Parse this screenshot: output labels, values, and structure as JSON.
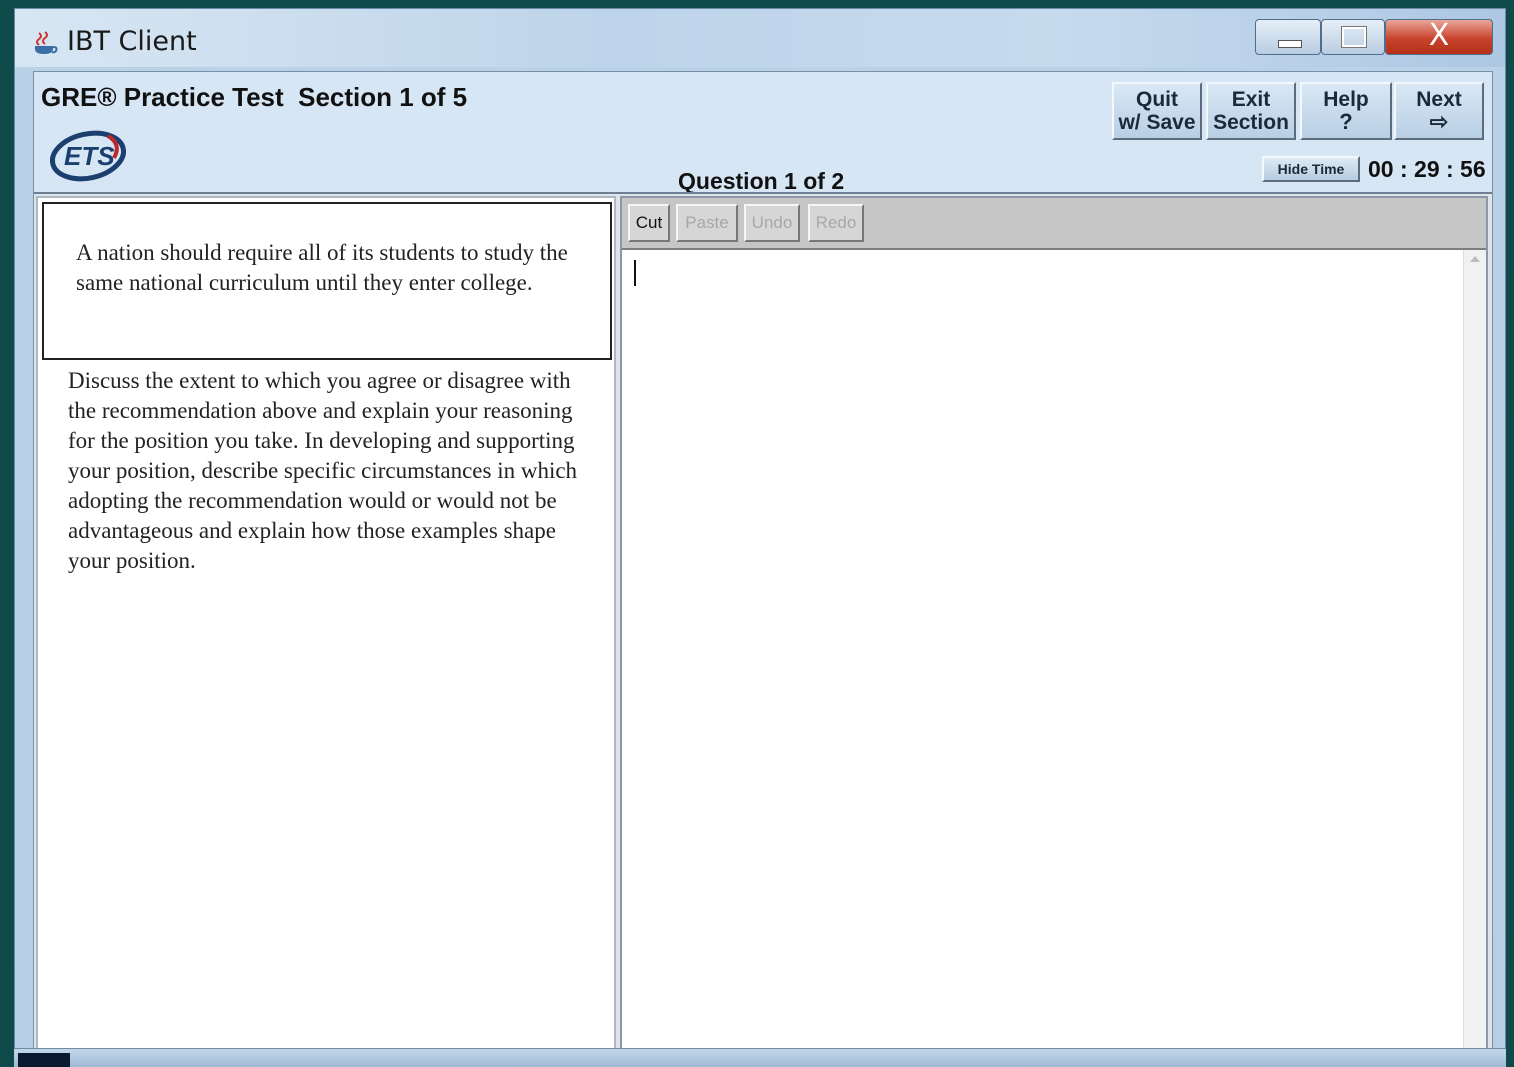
{
  "window": {
    "title": "IBT Client",
    "close_label": "X"
  },
  "header": {
    "test_title": "GRE® Practice Test  Section 1 of 5",
    "logo_text": "ETS",
    "question_counter": "Question 1 of 2",
    "buttons": {
      "quit_line1": "Quit",
      "quit_line2": "w/ Save",
      "exit_line1": "Exit",
      "exit_line2": "Section",
      "help_label": "Help",
      "help_glyph": "?",
      "next_label": "Next",
      "next_glyph": "⇨"
    },
    "hide_time_label": "Hide Time",
    "timer": "00 : 29 : 56"
  },
  "question": {
    "prompt": "A nation should require all of its students to study the same national curriculum until they enter college.",
    "instructions": "Discuss the extent to which you agree or disagree with the recommendation above and explain your reasoning for the position you take. In developing and supporting your position, describe specific circumstances in which adopting the recommendation would or would not be advantageous and explain how those examples shape your position."
  },
  "editor": {
    "cut_label": "Cut",
    "paste_label": "Paste",
    "undo_label": "Undo",
    "redo_label": "Redo",
    "essay_text": ""
  },
  "colors": {
    "close_button": "#c8432c",
    "header_bg": "#d6e6f4",
    "disabled_text": "#a8a8a8"
  }
}
